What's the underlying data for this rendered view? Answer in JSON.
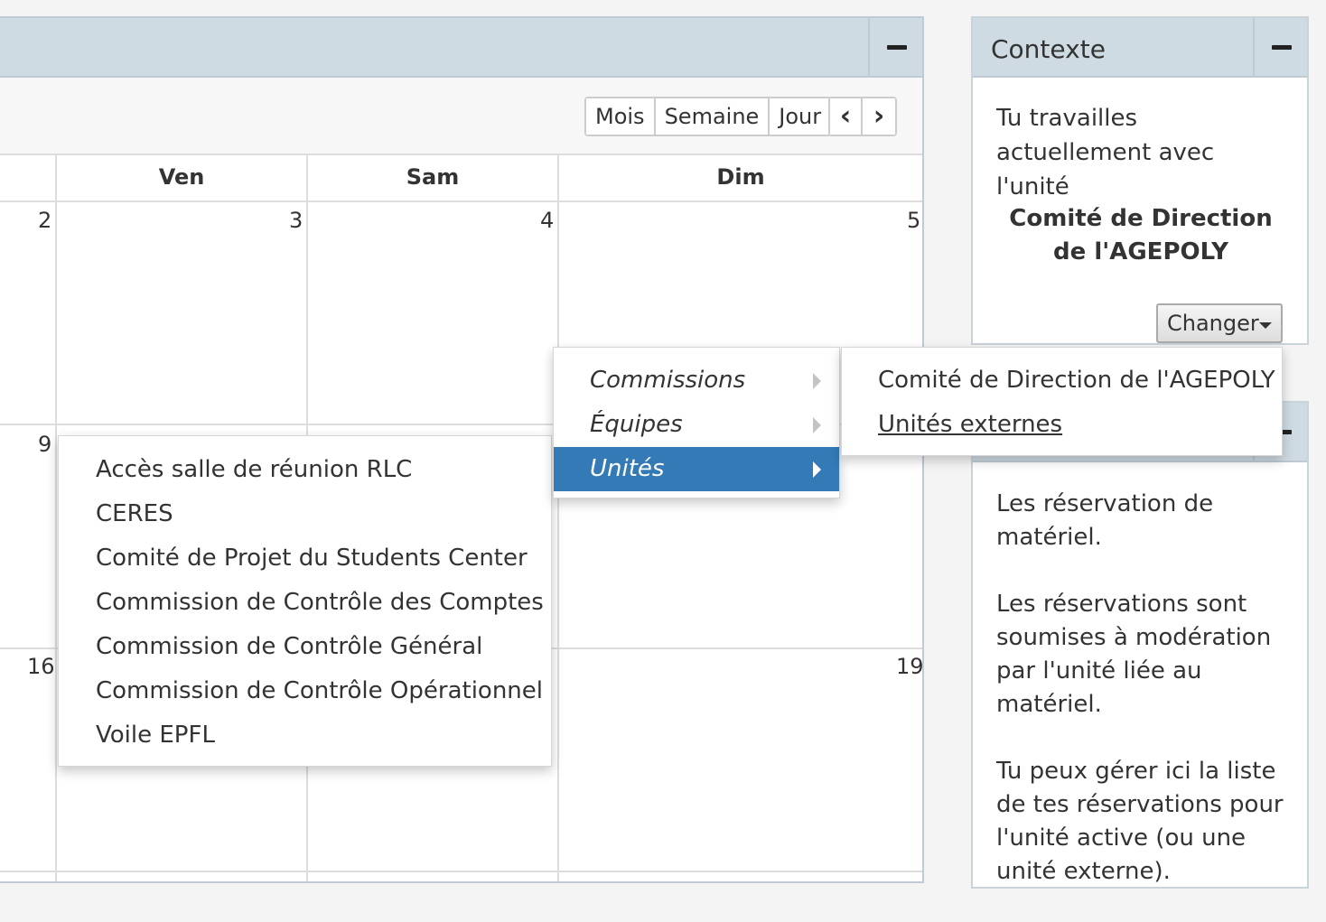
{
  "calendar": {
    "view_buttons": [
      "Mois",
      "Semaine",
      "Jour"
    ],
    "prev_icon": "chevron-left-icon",
    "next_icon": "chevron-right-icon",
    "prev_glyph": "‹",
    "next_glyph": "›",
    "day_headers": [
      "Ven",
      "Sam",
      "Dim"
    ],
    "rows": [
      [
        "2",
        "3",
        "4",
        "5"
      ],
      [
        "9",
        "",
        "",
        ""
      ],
      [
        "16",
        "",
        "",
        "19"
      ]
    ]
  },
  "context_panel": {
    "title": "Contexte",
    "text": "Tu travailles actuellement avec l'unité",
    "unit": "Comité de Direction de l'AGEPOLY",
    "change_button": "Changer"
  },
  "info_panel": {
    "paragraphs": [
      "Les réservation de matériel.",
      "Les réservations sont soumises à modération par l'unité liée au matériel.",
      "Tu peux gérer ici la liste de tes réservations pour l'unité active (ou une unité externe)."
    ]
  },
  "menus": {
    "main": [
      {
        "label": "Commissions",
        "active": false
      },
      {
        "label": "Équipes",
        "active": false
      },
      {
        "label": "Unités",
        "active": true
      }
    ],
    "sub": [
      {
        "label": "Comité de Direction de l'AGEPOLY",
        "underline": false
      },
      {
        "label": "Unités externes",
        "underline": true
      }
    ],
    "units": [
      "Accès salle de réunion RLC",
      "CERES",
      "Comité de Projet du Students Center",
      "Commission de Contrôle des Comptes",
      "Commission de Contrôle Général",
      "Commission de Contrôle Opérationnel",
      "Voile EPFL"
    ]
  },
  "colors": {
    "header_bg": "#cfdbe3",
    "active_item": "#337ab7"
  }
}
